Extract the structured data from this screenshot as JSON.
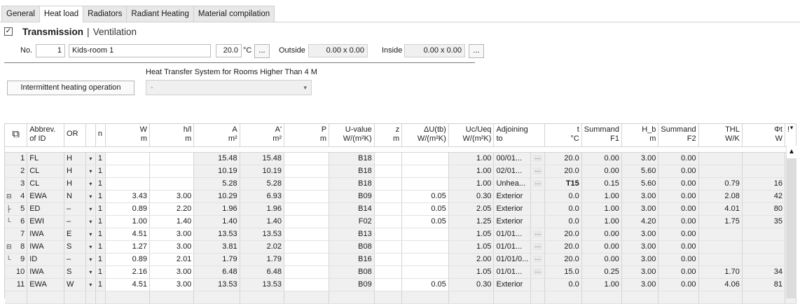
{
  "tabs": [
    "General",
    "Heat load",
    "Radiators",
    "Radiant Heating",
    "Material compilation"
  ],
  "active_tab": 1,
  "mode": {
    "checked_glyph": "✓",
    "transmission": "Transmission",
    "separator": "|",
    "ventilation": "Ventilation"
  },
  "room": {
    "no_label": "No.",
    "no_value": "1",
    "name_value": "Kids-room 1",
    "temp_value": "20.0",
    "temp_unit": "°C",
    "dots": "...",
    "outside_label": "Outside",
    "outside_value": "0.00 x 0.00",
    "inside_label": "Inside",
    "inside_value": "0.00 x 0.00"
  },
  "hts": {
    "label": "Heat Transfer System for Rooms Higher Than 4 M",
    "value": "-",
    "arrow": "▾"
  },
  "intermittent_button": "Intermittent heating operation",
  "grid": {
    "headers": [
      {
        "l1": "",
        "l2": ""
      },
      {
        "l1": "Abbrev.",
        "l2": "of ID"
      },
      {
        "l1": "OR",
        "l2": ""
      },
      {
        "l1": "",
        "l2": ""
      },
      {
        "l1": "n",
        "l2": ""
      },
      {
        "l1": "W",
        "l2": "m"
      },
      {
        "l1": "h/l",
        "l2": "m"
      },
      {
        "l1": "A",
        "l2": "m²"
      },
      {
        "l1": "A'",
        "l2": "m²"
      },
      {
        "l1": "P",
        "l2": "m"
      },
      {
        "l1": "U-value",
        "l2": "W/(m²K)"
      },
      {
        "l1": "z",
        "l2": "m"
      },
      {
        "l1": "ΔU(tb)",
        "l2": "W/(m²K)"
      },
      {
        "l1": "Uc/Ueq",
        "l2": "W/(m²K)"
      },
      {
        "l1": "Adjoining",
        "l2": "to"
      },
      {
        "l1": "",
        "l2": ""
      },
      {
        "l1": "t",
        "l2": "°C"
      },
      {
        "l1": "Summand",
        "l2": "F1"
      },
      {
        "l1": "H_b",
        "l2": "m"
      },
      {
        "l1": "Summand",
        "l2": "F2"
      },
      {
        "l1": "THL",
        "l2": "W/K"
      },
      {
        "l1": "Φt",
        "l2": "W"
      },
      {
        "l1": "!",
        "l2": ""
      }
    ],
    "copy_icon": "⧉",
    "rows": [
      {
        "no": "1",
        "id": "FL",
        "or": "H",
        "n": "1",
        "w": "",
        "h": "",
        "a": "15.48",
        "a2": "15.48",
        "p": "",
        "u": "B18",
        "z": "",
        "du": "",
        "uc": "1.00",
        "adj": "00/01...",
        "t": "20.0",
        "f1": "0.00",
        "hb": "3.00",
        "f2": "0.00",
        "thl": "",
        "phi": ""
      },
      {
        "no": "2",
        "id": "CL",
        "or": "H",
        "n": "1",
        "w": "",
        "h": "",
        "a": "10.19",
        "a2": "10.19",
        "p": "",
        "u": "B18",
        "z": "",
        "du": "",
        "uc": "1.00",
        "adj": "02/01...",
        "t": "20.0",
        "f1": "0.00",
        "hb": "5.60",
        "f2": "0.00",
        "thl": "",
        "phi": ""
      },
      {
        "no": "3",
        "id": "CL",
        "or": "H",
        "n": "1",
        "w": "",
        "h": "",
        "a": "5.28",
        "a2": "5.28",
        "p": "",
        "u": "B18",
        "z": "",
        "du": "",
        "uc": "1.00",
        "adj": "Unhea...",
        "t": "T15",
        "f1": "0.15",
        "hb": "5.60",
        "f2": "0.00",
        "thl": "0.79",
        "phi": "16"
      },
      {
        "no": "4",
        "id": "EWA",
        "or": "N",
        "n": "1",
        "w": "3.43",
        "h": "3.00",
        "a": "10.29",
        "a2": "6.93",
        "p": "",
        "u": "B09",
        "z": "",
        "du": "0.05",
        "uc": "0.30",
        "adj": "Exterior",
        "t": "0.0",
        "f1": "1.00",
        "hb": "3.00",
        "f2": "0.00",
        "thl": "2.08",
        "phi": "42"
      },
      {
        "no": "5",
        "id": "ED",
        "or": "–",
        "n": "1",
        "w": "0.89",
        "h": "2.20",
        "a": "1.96",
        "a2": "1.96",
        "p": "",
        "u": "B14",
        "z": "",
        "du": "0.05",
        "uc": "2.05",
        "adj": "Exterior",
        "t": "0.0",
        "f1": "1.00",
        "hb": "3.00",
        "f2": "0.00",
        "thl": "4.01",
        "phi": "80"
      },
      {
        "no": "6",
        "id": "EWI",
        "or": "–",
        "n": "1",
        "w": "1.00",
        "h": "1.40",
        "a": "1.40",
        "a2": "1.40",
        "p": "",
        "u": "F02",
        "z": "",
        "du": "0.05",
        "uc": "1.25",
        "adj": "Exterior",
        "t": "0.0",
        "f1": "1.00",
        "hb": "4.20",
        "f2": "0.00",
        "thl": "1.75",
        "phi": "35"
      },
      {
        "no": "7",
        "id": "IWA",
        "or": "E",
        "n": "1",
        "w": "4.51",
        "h": "3.00",
        "a": "13.53",
        "a2": "13.53",
        "p": "",
        "u": "B13",
        "z": "",
        "du": "",
        "uc": "1.05",
        "adj": "01/01...",
        "t": "20.0",
        "f1": "0.00",
        "hb": "3.00",
        "f2": "0.00",
        "thl": "",
        "phi": ""
      },
      {
        "no": "8",
        "id": "IWA",
        "or": "S",
        "n": "1",
        "w": "1.27",
        "h": "3.00",
        "a": "3.81",
        "a2": "2.02",
        "p": "",
        "u": "B08",
        "z": "",
        "du": "",
        "uc": "1.05",
        "adj": "01/01...",
        "t": "20.0",
        "f1": "0.00",
        "hb": "3.00",
        "f2": "0.00",
        "thl": "",
        "phi": ""
      },
      {
        "no": "9",
        "id": "ID",
        "or": "–",
        "n": "1",
        "w": "0.89",
        "h": "2.01",
        "a": "1.79",
        "a2": "1.79",
        "p": "",
        "u": "B16",
        "z": "",
        "du": "",
        "uc": "2.00",
        "adj": "01/01/0...",
        "t": "20.0",
        "f1": "0.00",
        "hb": "3.00",
        "f2": "0.00",
        "thl": "",
        "phi": ""
      },
      {
        "no": "10",
        "id": "IWA",
        "or": "S",
        "n": "1",
        "w": "2.16",
        "h": "3.00",
        "a": "6.48",
        "a2": "6.48",
        "p": "",
        "u": "B08",
        "z": "",
        "du": "",
        "uc": "1.05",
        "adj": "01/01...",
        "t": "15.0",
        "f1": "0.25",
        "hb": "3.00",
        "f2": "0.00",
        "thl": "1.70",
        "phi": "34"
      },
      {
        "no": "11",
        "id": "EWA",
        "or": "W",
        "n": "1",
        "w": "4.51",
        "h": "3.00",
        "a": "13.53",
        "a2": "13.53",
        "p": "",
        "u": "B09",
        "z": "",
        "du": "0.05",
        "uc": "0.30",
        "adj": "Exterior",
        "t": "0.0",
        "f1": "1.00",
        "hb": "3.00",
        "f2": "0.00",
        "thl": "4.06",
        "phi": "81"
      }
    ],
    "tree_markers": {
      "4": "⊟",
      "5": "├",
      "6": "└",
      "8": "⊟",
      "9": "└"
    },
    "dd_arrow": "▾",
    "ellipsis": "···",
    "scroll_up": "▲",
    "col_menu": "▾"
  }
}
